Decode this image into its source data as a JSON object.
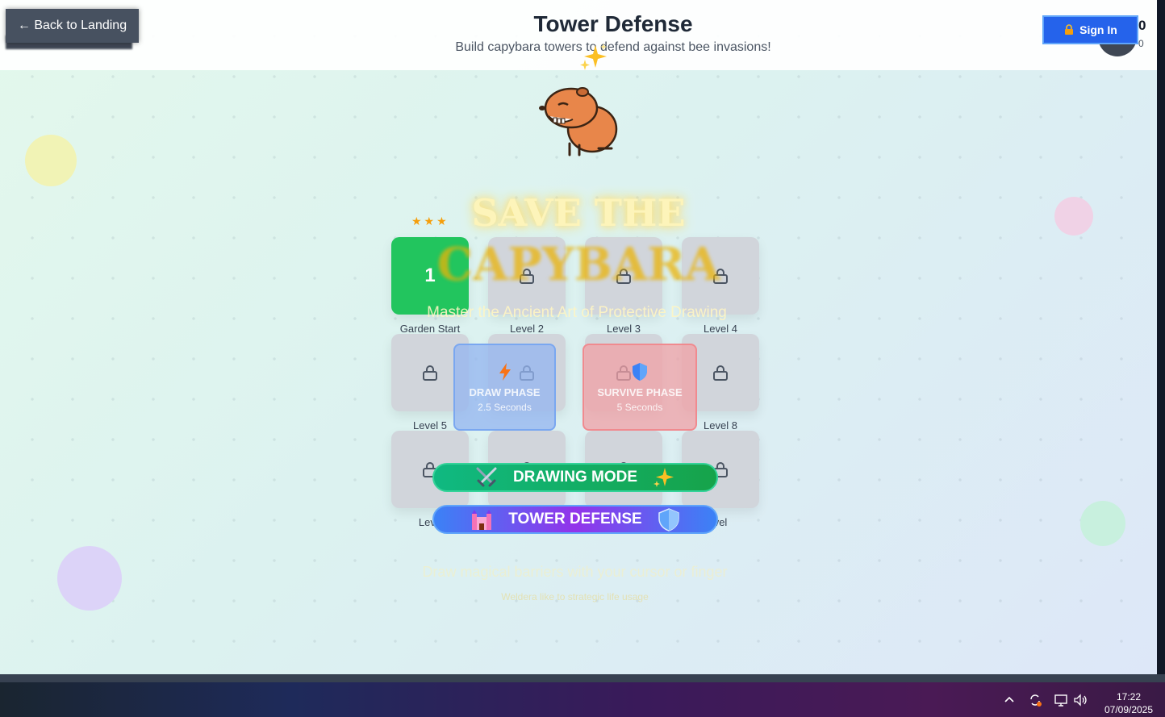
{
  "header": {
    "title": "Tower Defense",
    "subtitle": "Build capybara towers to defend against bee invasions!",
    "back_label": "← Back to Landing",
    "signin_label": "Sign In",
    "score": "0",
    "score_sub": "0"
  },
  "overlay": {
    "title_line1": "SAVE THE",
    "title_line2": "CAPYBARA",
    "tagline": "Master the Ancient Art of Protective Drawing",
    "phases": [
      {
        "title": "DRAW PHASE",
        "duration": "2.5 Seconds",
        "icon": "lightning-icon"
      },
      {
        "title": "SURVIVE PHASE",
        "duration": "5 Seconds",
        "icon": "shield-icon"
      }
    ],
    "modes": [
      {
        "label": "DRAWING MODE",
        "left_icon": "crossed-swords-icon",
        "right_icon": "sparkles-icon"
      },
      {
        "label": "TOWER DEFENSE",
        "left_icon": "castle-icon",
        "right_icon": "shield-icon"
      }
    ],
    "hint": "Draw magical barriers with your cursor or finger",
    "hint_sub": "Weldera like to strategic life usage"
  },
  "levels": {
    "stars": "★★★",
    "items": [
      {
        "number": "1",
        "label": "Garden Start",
        "locked": false
      },
      {
        "label": "Level 2",
        "locked": true
      },
      {
        "label": "Level 3",
        "locked": true
      },
      {
        "label": "Level 4",
        "locked": true
      },
      {
        "label": "Level 5",
        "locked": true
      },
      {
        "label": "",
        "locked": true
      },
      {
        "label": "",
        "locked": true
      },
      {
        "label": "Level 8",
        "locked": true
      },
      {
        "label": "Leve",
        "locked": true
      },
      {
        "label": "",
        "locked": true
      },
      {
        "label": "",
        "locked": true
      },
      {
        "label": "vel",
        "locked": true
      }
    ]
  },
  "taskbar": {
    "time": "17:22",
    "date": "07/09/2025"
  },
  "colors": {
    "primary_blue": "#2563eb",
    "unlocked_green": "#22c55e",
    "locked_gray": "#d1d5db",
    "title_gold": "#eab308"
  }
}
